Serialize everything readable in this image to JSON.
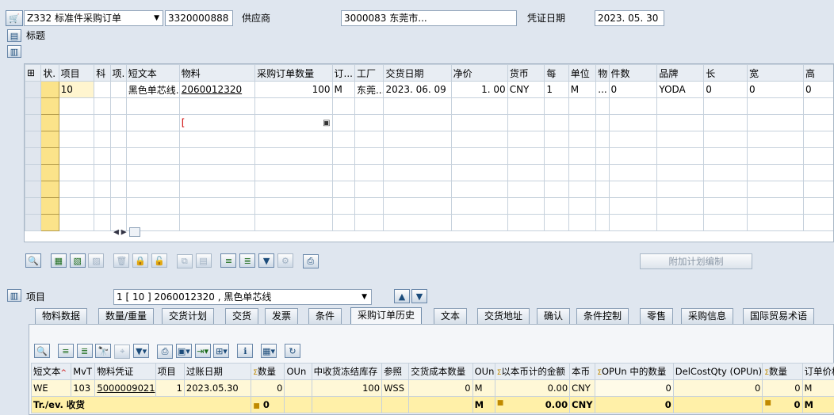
{
  "header": {
    "doc_type_value": "Z332 标准件采购订单",
    "doc_number": "3320000888",
    "vendor_label": "供应商",
    "vendor_value": "3000083 东莞市...",
    "doc_date_label": "凭证日期",
    "doc_date_value": "2023. 05. 30",
    "header_label": "标题"
  },
  "items_table": {
    "columns": [
      "状.",
      "项目",
      "科",
      "项.",
      "短文本",
      "物料",
      "采购订单数量",
      "订...",
      "工厂",
      "交货日期",
      "净价",
      "货币",
      "每",
      "单位",
      "物",
      "件数",
      "品牌",
      "长",
      "宽",
      "高"
    ],
    "rows": [
      {
        "item": "10",
        "short_text": "黑色单芯线...",
        "material": "2060012320",
        "qty": "100",
        "uom": "M",
        "plant": "东莞...",
        "delivery_date": "2023. 06. 09",
        "net_price": "1. 00",
        "currency": "CNY",
        "per": "1",
        "unit": "M",
        "flag": "...",
        "pieces": "0",
        "brand": "YODA",
        "length": "0",
        "width": "0",
        "height": "0"
      }
    ]
  },
  "toolbar": {
    "additional_planning": "附加计划编制"
  },
  "item_selector": {
    "label": "项目",
    "value": "1 [ 10 ] 2060012320 , 黑色单芯线"
  },
  "tabs": [
    "物料数据",
    "数量/重量",
    "交货计划",
    "交货",
    "发票",
    "条件",
    "采购订单历史",
    "文本",
    "交货地址",
    "确认",
    "条件控制",
    "零售",
    "采购信息",
    "国际贸易术语"
  ],
  "active_tab": "采购订单历史",
  "history": {
    "columns": [
      "短文本",
      "MvT",
      "物料凭证",
      "项目",
      "过账日期",
      "数量",
      "OUn",
      "中收货冻结库存",
      "参照",
      "交货成本数量",
      "OUn",
      "以本币计的金额",
      "本币",
      "OPUn 中的数量",
      "DelCostQty (OPUn)",
      "数量",
      "订单价格单"
    ],
    "row": {
      "short_text": "WE",
      "mvt": "103",
      "mat_doc": "5000009021",
      "item": "1",
      "post_date": "2023.05.30",
      "qty": "0",
      "oun": "",
      "blocked_stock": "100",
      "ref": "WSS",
      "del_cost_qty": "0",
      "oun2": "M",
      "amount": "0.00",
      "currency": "CNY",
      "opun_qty": "0",
      "delcost_opun": "0",
      "qty2": "0",
      "opu": "M"
    },
    "total": {
      "label": "Tr./ev. 收货",
      "qty": "0",
      "oun2": "M",
      "amount": "0.00",
      "currency": "CNY",
      "opun_qty": "0",
      "qty2": "0",
      "opu": "M"
    }
  },
  "colors": {
    "accent": "#dfe6ef",
    "row_yellow": "#fff5cf",
    "total_yellow": "#fff0a8"
  }
}
